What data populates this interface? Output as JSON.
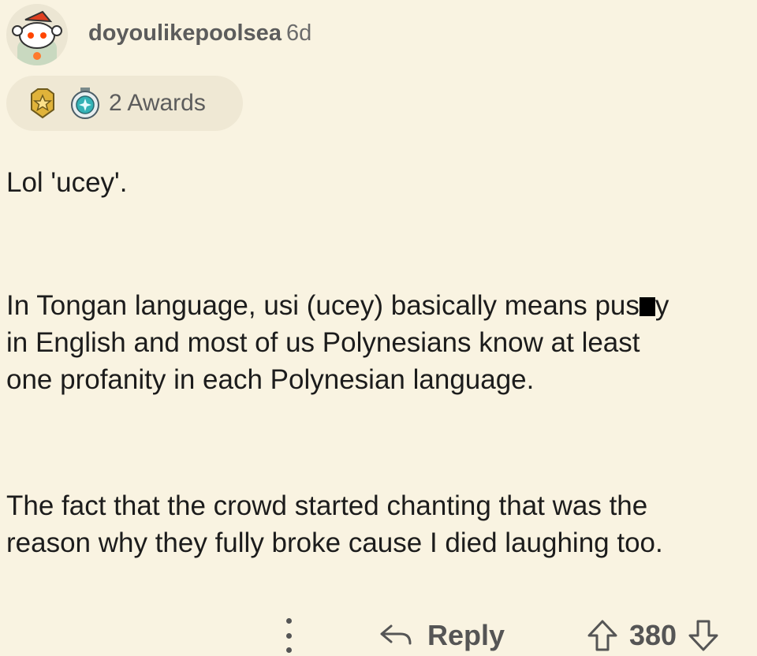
{
  "comment": {
    "author": "doyoulikepoolsea",
    "age": "6d",
    "awards_label": "2 Awards",
    "paragraphs": {
      "p1": "Lol 'ucey'.",
      "p2_line1_a": "In Tongan language, usi (ucey) basically means pus",
      "p2_line1_b": "y",
      "p2_line2": "in English and most of us Polynesians know at least",
      "p2_line3": "one profanity in each Polynesian language.",
      "p3_line1": "The fact that the crowd started chanting that was the",
      "p3_line2": "reason why they fully broke cause I died laughing too."
    }
  },
  "actions": {
    "reply_label": "Reply",
    "score": "380"
  },
  "icons": {
    "avatar": "snoo-avatar",
    "award1": "gold-star-award-icon",
    "award2": "diamond-award-icon",
    "more": "more-vertical-icon",
    "reply": "reply-arrow-icon",
    "upvote": "upvote-arrow-icon",
    "downvote": "downvote-arrow-icon"
  },
  "colors": {
    "background": "#f9f3e1",
    "text": "#1c1c1c",
    "muted": "#5c5c5c"
  }
}
